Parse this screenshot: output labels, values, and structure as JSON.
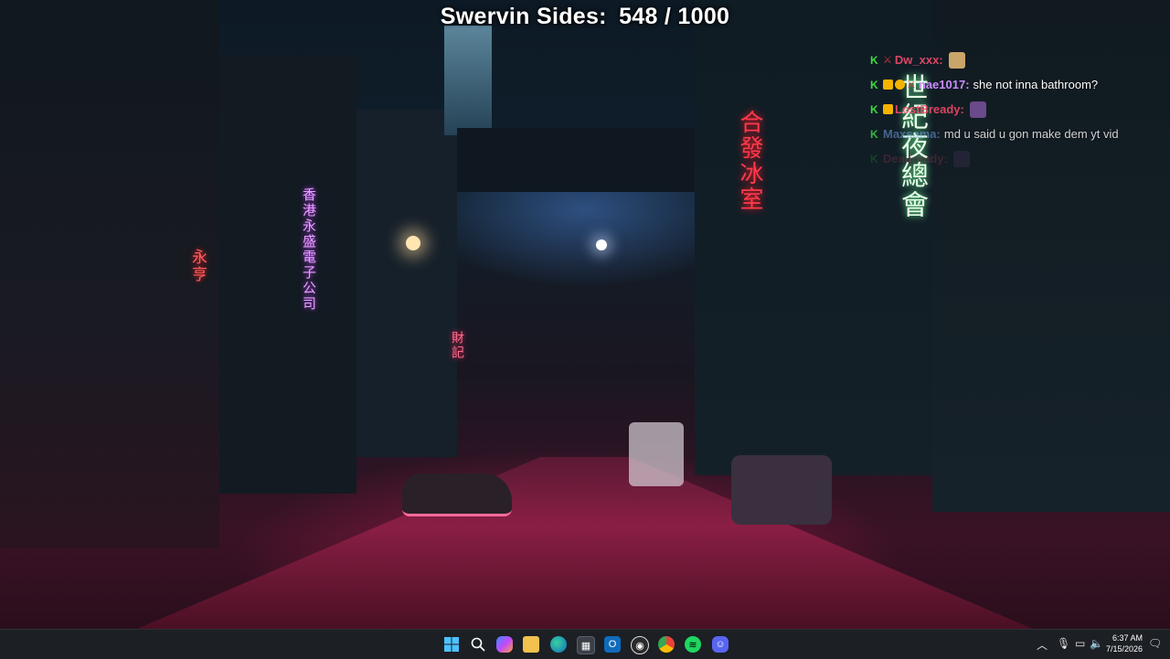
{
  "overlay": {
    "label": "Swervin Sides:",
    "value": "548 / 1000"
  },
  "chat": [
    {
      "user": "Dw_xxx:",
      "user_color": "#ff4d6d",
      "message": "",
      "emote": "thumbs-emote",
      "faded": false
    },
    {
      "user": "nae1017:",
      "user_color": "#c98cff",
      "message": "she not inna bathroom?",
      "emote": "",
      "faded": false
    },
    {
      "user": "LostBready:",
      "user_color": "#ff4d6d",
      "message": "",
      "emote": "face-emote",
      "faded": false
    },
    {
      "user": "Maxsama:",
      "user_color": "#7fb3ff",
      "message": "md u said u gon make dem yt vid",
      "emote": "",
      "faded": true
    },
    {
      "user": "Deadready:",
      "user_color": "#ff4d6d",
      "message": "",
      "emote": "face-emote",
      "faded": true
    }
  ],
  "wallpaper_signs": {
    "left_tall": "香港永盛電子公司",
    "left_small": "永亨",
    "center": "財記",
    "right_tall": "合發冰室",
    "far_right": "世紀夜總會"
  },
  "taskbar": {
    "icons": [
      "start-icon",
      "search-icon",
      "copilot-icon",
      "file-explorer-icon",
      "edge-icon",
      "store-icon",
      "outlook-icon",
      "obs-icon",
      "chrome-icon",
      "spotify-icon",
      "discord-icon"
    ],
    "time": "6:37 AM",
    "date": "7/15/2026"
  }
}
